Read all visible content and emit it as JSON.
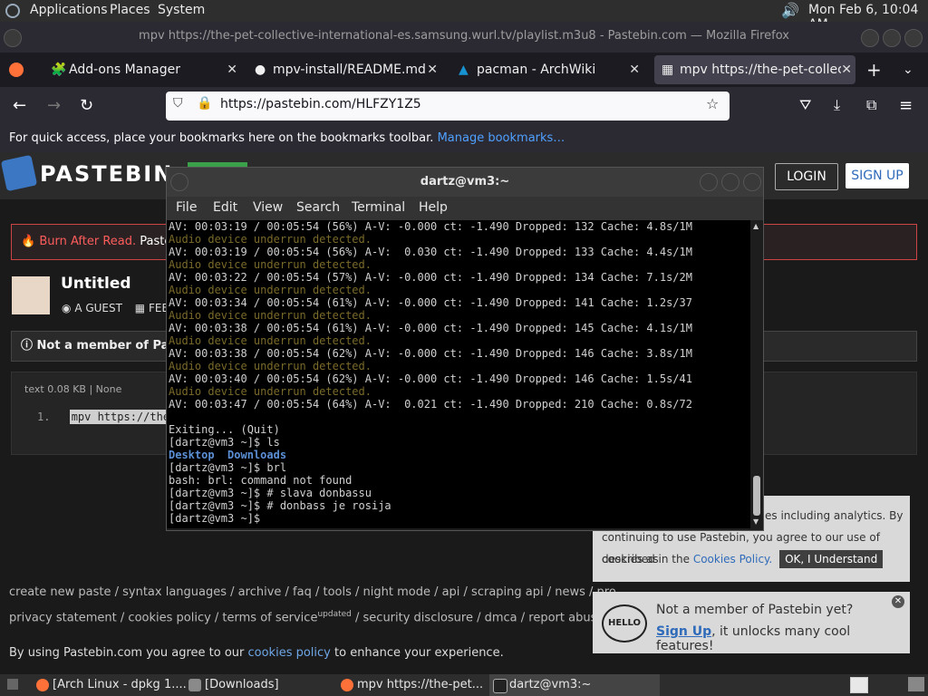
{
  "top_panel": {
    "menus": [
      "Applications",
      "Places",
      "System"
    ],
    "clock": "Mon Feb 6, 10:04 AM"
  },
  "firefox": {
    "window_title": "mpv https://the-pet-collective-international-es.samsung.wurl.tv/playlist.m3u8 - Pastebin.com — Mozilla Firefox",
    "tabs": [
      {
        "label": "Add-ons Manager"
      },
      {
        "label": "mpv-install/README.md at"
      },
      {
        "label": "pacman - ArchWiki"
      },
      {
        "label": "mpv https://the-pet-collect"
      }
    ],
    "url": "https://pastebin.com/HLFZY1Z5",
    "bookmarks_text": "For quick access, place your bookmarks here on the bookmarks toolbar.",
    "bookmarks_link": "Manage bookmarks…"
  },
  "pastebin": {
    "logo_text": "PASTEBIN",
    "login": "LOGIN",
    "signup": "SIGN UP",
    "burn_label": "Burn After Read.",
    "burn_text": "Paste",
    "paste_title": "Untitled",
    "author": "A GUEST",
    "date_prefix": "FEE",
    "member_notice": "Not a member of Past",
    "code_info": "text   0.08 KB | None",
    "code_line_no": "1.",
    "code_line": "mpv https://the-",
    "footer_row1": "create new paste  /  syntax languages  /  archive  /  faq  /  tools  /  night mode  /  api  /  scraping api  /  news  /  pro",
    "footer_row2": "privacy statement  /  cookies policy  /  terms of service",
    "footer_row2_sup": "updated",
    "footer_row2_rest": "  /  security disclosure  /  dmca  /  report abuse  /  conta",
    "agree_prefix": "By using Pastebin.com you agree to our",
    "agree_link": "cookies policy",
    "agree_suffix": "to enhance your experience.",
    "cookie_line1": "es including analytics. By",
    "cookie_line2": "continuing to use Pastebin, you agree to our use of cookies as",
    "cookie_line3_prefix": "described in the",
    "cookie_link": "Cookies Policy.",
    "cookie_ok": "OK, I Understand",
    "notmember_title": "Not a member of Pastebin yet?",
    "notmember_link": "Sign Up",
    "notmember_rest": ", it unlocks many cool features!",
    "hello_badge": "HELLO"
  },
  "terminal": {
    "title": "dartz@vm3:~",
    "menu": [
      "File",
      "Edit",
      "View",
      "Search",
      "Terminal",
      "Help"
    ],
    "lines": [
      {
        "t": "AV: 00:03:19 / 00:05:54 (56%) A-V: -0.000 ct: -1.490 Dropped: 132 Cache: 4.8s/1M",
        "c": ""
      },
      {
        "t": "Audio device underrun detected.",
        "c": "warn"
      },
      {
        "t": "AV: 00:03:19 / 00:05:54 (56%) A-V:  0.030 ct: -1.490 Dropped: 133 Cache: 4.4s/1M",
        "c": ""
      },
      {
        "t": "Audio device underrun detected.",
        "c": "warn"
      },
      {
        "t": "AV: 00:03:22 / 00:05:54 (57%) A-V: -0.000 ct: -1.490 Dropped: 134 Cache: 7.1s/2M",
        "c": ""
      },
      {
        "t": "Audio device underrun detected.",
        "c": "warn"
      },
      {
        "t": "AV: 00:03:34 / 00:05:54 (61%) A-V: -0.000 ct: -1.490 Dropped: 141 Cache: 1.2s/37",
        "c": ""
      },
      {
        "t": "Audio device underrun detected.",
        "c": "warn"
      },
      {
        "t": "AV: 00:03:38 / 00:05:54 (61%) A-V: -0.000 ct: -1.490 Dropped: 145 Cache: 4.1s/1M",
        "c": ""
      },
      {
        "t": "Audio device underrun detected.",
        "c": "warn"
      },
      {
        "t": "AV: 00:03:38 / 00:05:54 (62%) A-V: -0.000 ct: -1.490 Dropped: 146 Cache: 3.8s/1M",
        "c": ""
      },
      {
        "t": "Audio device underrun detected.",
        "c": "warn"
      },
      {
        "t": "AV: 00:03:40 / 00:05:54 (62%) A-V: -0.000 ct: -1.490 Dropped: 146 Cache: 1.5s/41",
        "c": ""
      },
      {
        "t": "Audio device underrun detected.",
        "c": "warn"
      },
      {
        "t": "AV: 00:03:47 / 00:05:54 (64%) A-V:  0.021 ct: -1.490 Dropped: 210 Cache: 0.8s/72",
        "c": ""
      },
      {
        "t": "",
        "c": ""
      },
      {
        "t": "Exiting... (Quit)",
        "c": ""
      },
      {
        "t": "[dartz@vm3 ~]$ ls",
        "c": ""
      },
      {
        "t": "Desktop  Downloads",
        "c": "blue"
      },
      {
        "t": "[dartz@vm3 ~]$ brl",
        "c": ""
      },
      {
        "t": "bash: brl: command not found",
        "c": ""
      },
      {
        "t": "[dartz@vm3 ~]$ # slava donbassu",
        "c": ""
      },
      {
        "t": "[dartz@vm3 ~]$ # donbass je rosija",
        "c": ""
      },
      {
        "t": "[dartz@vm3 ~]$ ",
        "c": ""
      }
    ]
  },
  "taskbar": {
    "items": [
      {
        "label": "[Arch Linux - dpkg 1...."
      },
      {
        "label": "[Downloads]"
      },
      {
        "label": "mpv https://the-pet..."
      },
      {
        "label": "dartz@vm3:~"
      }
    ]
  }
}
